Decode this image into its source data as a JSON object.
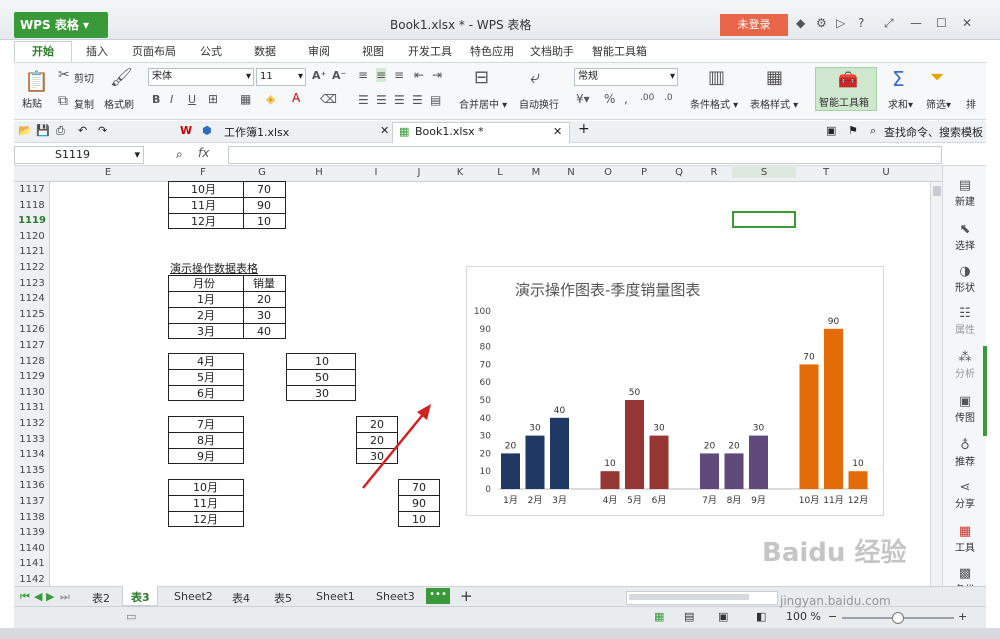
{
  "window": {
    "title": "Book1.xlsx * - WPS 表格",
    "app_name": "WPS 表格",
    "login": "未登录"
  },
  "ribbon_tabs": [
    "开始",
    "插入",
    "页面布局",
    "公式",
    "数据",
    "审阅",
    "视图",
    "开发工具",
    "特色应用",
    "文档助手",
    "智能工具箱"
  ],
  "ribbon": {
    "paste": "粘贴",
    "cut": "剪切",
    "copy": "复制",
    "format_brush": "格式刷",
    "font": "宋体",
    "font_size": "11",
    "merge": "合并居中",
    "wrap": "自动换行",
    "number_format": "常规",
    "conditional": "条件格式",
    "table_style": "表格样式",
    "smart_box": "智能工具箱",
    "sum": "求和",
    "filter": "筛选",
    "sort": "排"
  },
  "doc_tabs": [
    "工作簿1.xlsx",
    "Book1.xlsx *"
  ],
  "search_hint": "查找命令、搜索模板",
  "formula": {
    "name_box": "S1119",
    "fx": "fx"
  },
  "columns": [
    "E",
    "F",
    "G",
    "H",
    "I",
    "J",
    "K",
    "L",
    "M",
    "N",
    "O",
    "P",
    "Q",
    "R",
    "S",
    "T",
    "U"
  ],
  "rows": [
    "1117",
    "1118",
    "1119",
    "1120",
    "1121",
    "1122",
    "1123",
    "1124",
    "1125",
    "1126",
    "1127",
    "1128",
    "1129",
    "1130",
    "1131",
    "1132",
    "1133",
    "1134",
    "1135",
    "1136",
    "1137",
    "1138",
    "1139",
    "1140",
    "1141",
    "1142"
  ],
  "cells": {
    "top": [
      [
        "10月",
        "70"
      ],
      [
        "11月",
        "90"
      ],
      [
        "12月",
        "10"
      ]
    ],
    "table_title": "演示操作数据表格",
    "header": [
      "月份",
      "销量"
    ],
    "q1": [
      [
        "1月",
        "20"
      ],
      [
        "2月",
        "30"
      ],
      [
        "3月",
        "40"
      ]
    ],
    "q2_months": [
      "4月",
      "5月",
      "6月"
    ],
    "q2_values": [
      "10",
      "50",
      "30"
    ],
    "q3_months": [
      "7月",
      "8月",
      "9月"
    ],
    "q3_values": [
      "20",
      "20",
      "30"
    ],
    "q4_months": [
      "10月",
      "11月",
      "12月"
    ],
    "q4_values": [
      "70",
      "90",
      "10"
    ]
  },
  "chart_data": {
    "type": "bar",
    "title": "演示操作图表-季度销量图表",
    "categories": [
      "1月",
      "2月",
      "3月",
      "4月",
      "5月",
      "6月",
      "7月",
      "8月",
      "9月",
      "10月",
      "11月",
      "12月"
    ],
    "values": [
      20,
      30,
      40,
      10,
      50,
      30,
      20,
      20,
      30,
      70,
      90,
      10
    ],
    "colors": [
      "#1f3864",
      "#1f3864",
      "#1f3864",
      "#963634",
      "#963634",
      "#963634",
      "#604a7b",
      "#604a7b",
      "#604a7b",
      "#e36c09",
      "#e36c09",
      "#e36c09"
    ],
    "ylim": [
      0,
      100
    ],
    "yticks": [
      "0",
      "10",
      "20",
      "30",
      "40",
      "50",
      "60",
      "70",
      "80",
      "90",
      "100"
    ],
    "grid": false,
    "legend": "none"
  },
  "right_pane": [
    "新建",
    "选择",
    "形状",
    "属性",
    "分析",
    "传图",
    "推荐",
    "分享",
    "工具",
    "备份"
  ],
  "sheet_tabs": [
    "表2",
    "表3",
    "Sheet2",
    "表4",
    "表5",
    "Sheet1",
    "Sheet3"
  ],
  "status": {
    "zoom": "100 %"
  },
  "watermark": {
    "line1": "Baidu 经验",
    "line2": "jingyan.baidu.com"
  }
}
